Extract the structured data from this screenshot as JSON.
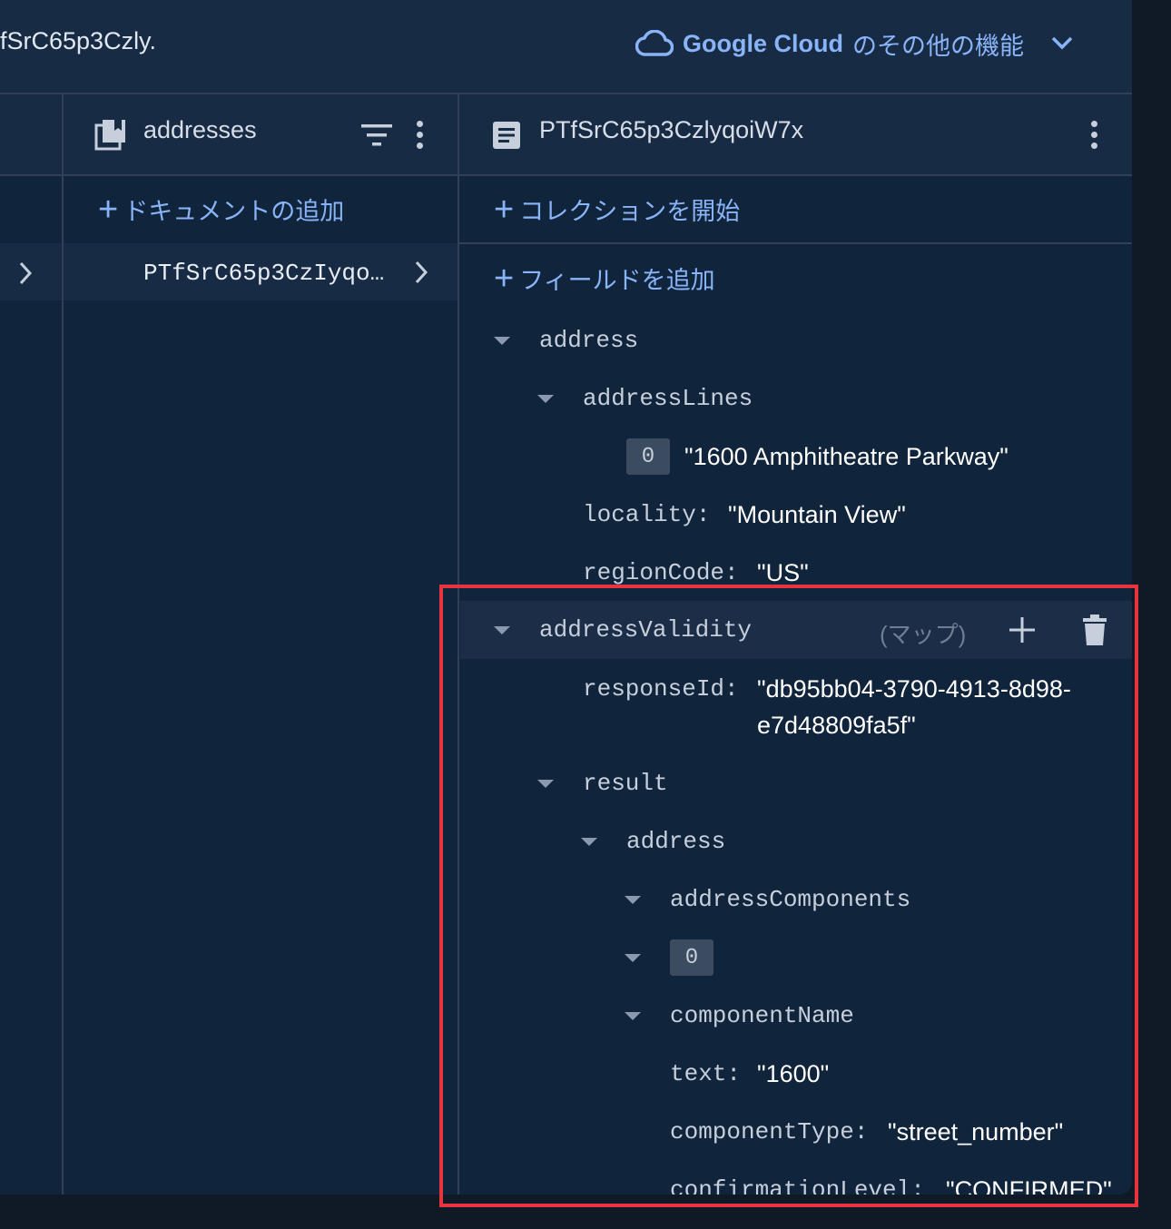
{
  "breadcrumb": {
    "text": "fSrC65p3Czly."
  },
  "header": {
    "cloud_brand": "Google Cloud",
    "cloud_suffix": "のその他の機能"
  },
  "collection": {
    "name": "addresses",
    "add_document_label": "ドキュメントの追加",
    "document_item": "PTfSrC65p3CzIyqo…"
  },
  "document": {
    "id": "PTfSrC65p3CzlyqoiW7x",
    "start_collection_label": "コレクションを開始",
    "add_field_label": "フィールドを追加"
  },
  "fields": {
    "address_key": "address",
    "address_lines_key": "addressLines",
    "address_lines_index": "0",
    "address_lines_value": "\"1600 Amphitheatre Parkway\"",
    "locality_key": "locality:",
    "locality_value": "\"Mountain View\"",
    "region_key": "regionCode:",
    "region_value": "\"US\"",
    "validity_key": "addressValidity",
    "validity_type": "(マップ)",
    "response_key": "responseId:",
    "response_value_1": "\"db95bb04-3790-4913-8d98-",
    "response_value_2": "e7d48809fa5f\"",
    "result_key": "result",
    "result_address_key": "address",
    "components_key": "addressComponents",
    "components_index": "0",
    "component_name_key": "componentName",
    "text_key": "text:",
    "text_value": "\"1600\"",
    "component_type_key": "componentType:",
    "component_type_value": "\"street_number\"",
    "confirmation_key": "confirmationLevel:",
    "confirmation_value": "\"CONFIRMED\""
  },
  "colors": {
    "accent": "#8ab4f8",
    "panel": "#10243c",
    "header": "#182b45",
    "annotation": "#e8343f"
  }
}
